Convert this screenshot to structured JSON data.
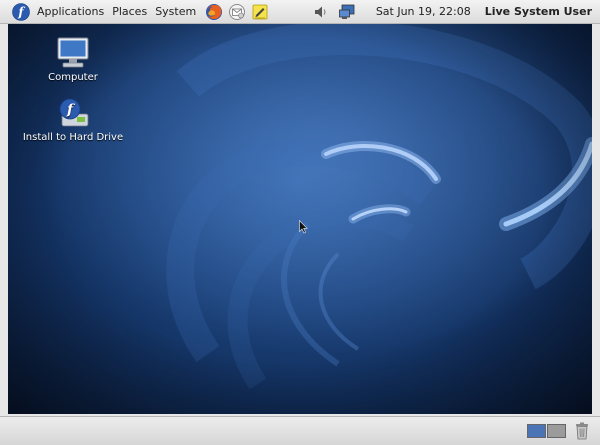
{
  "top_panel": {
    "menus": [
      "Applications",
      "Places",
      "System"
    ],
    "clock": "Sat Jun 19, 22:08",
    "user": "Live System User",
    "launchers": [
      "firefox-icon",
      "email-icon",
      "notes-icon"
    ],
    "tray": [
      "volume-icon",
      "network-icon"
    ]
  },
  "desktop": {
    "icons": [
      {
        "label": "Computer",
        "icon": "computer-icon"
      },
      {
        "label": "Install to Hard Drive",
        "icon": "install-icon"
      }
    ]
  },
  "bottom_panel": {
    "workspaces": 2,
    "active_workspace": 1,
    "trash_icon": "trash-icon"
  },
  "colors": {
    "panel": "#e3e3e3",
    "desktop_blue": "#1d457f",
    "accent": "#4a74b5"
  }
}
